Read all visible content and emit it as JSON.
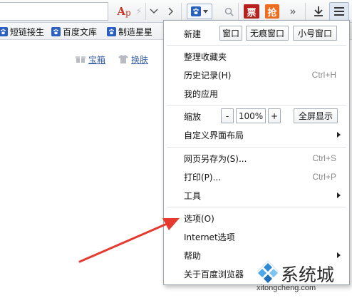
{
  "toolbar": {
    "ap_label_a": "A",
    "ap_label_p": "p",
    "piao_label": "票",
    "qiang_label": "抢",
    "more_label": "»"
  },
  "bookmarks": [
    {
      "label": "短链接生"
    },
    {
      "label": "百度文库"
    },
    {
      "label": "制造星星"
    }
  ],
  "page": {
    "link_baoxiang": "宝箱",
    "link_huanfu": "换肤"
  },
  "menu": {
    "new_label": "新建",
    "new_window": "窗口",
    "new_private": "无痕窗口",
    "new_small": "小号窗口",
    "organize_favorites": "整理收藏夹",
    "history": {
      "label": "历史记录(H)",
      "shortcut": "Ctrl+H"
    },
    "my_apps": "我的应用",
    "zoom": {
      "label": "缩放",
      "minus": "-",
      "value": "100%",
      "plus": "+",
      "fullscreen": "全屏显示"
    },
    "customize_layout": "自定义界面布局",
    "save_as": {
      "label": "网页另存为(S)...",
      "shortcut": "Ctrl+S"
    },
    "print": {
      "label": "打印(P)...",
      "shortcut": "Ctrl+P"
    },
    "tools": "工具",
    "options": "选项(O)",
    "internet_options": "Internet选项",
    "help": "帮助",
    "about": "关于百度浏览器"
  },
  "watermark": {
    "text": "系统城",
    "url": "xitongcheng.com"
  },
  "colors": {
    "accent_blue": "#2a5fc2",
    "arrow_red": "#e53a2f",
    "piao_red": "#b5231e",
    "qiang_orange": "#ef6b1e",
    "link_blue": "#3b62a6"
  }
}
